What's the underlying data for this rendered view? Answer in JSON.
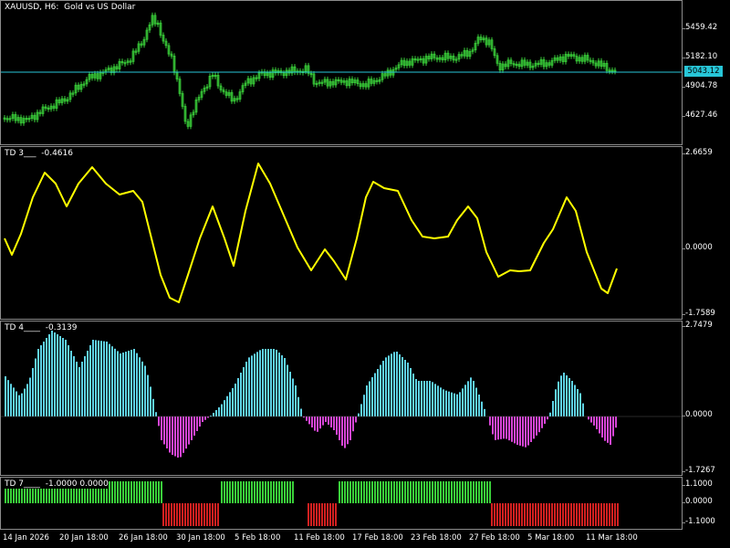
{
  "main": {
    "title": "XAUUSD, H6:  Gold vs US Dollar",
    "price_ticks": [
      "5459.42",
      "5182.10",
      "4904.78",
      "4627.46"
    ],
    "current_price": "5043.12",
    "candle_color": "#3ad13a",
    "hline_color": "#27c6d8"
  },
  "td3": {
    "label": "TD 3___  -0.4616",
    "ticks": [
      "2.6659",
      "0.0000",
      "-1.7589"
    ],
    "line_color": "#ffff00"
  },
  "td4": {
    "label": "TD 4____  -0.3139",
    "ticks": [
      "2.7479",
      "0.0000",
      "-1.7267"
    ],
    "pos_color": "#5fd3e6",
    "neg_color": "#d846d8"
  },
  "td7": {
    "label": "TD 7____  -1.0000 0.0000",
    "ticks": [
      "1.1000",
      "0.0000",
      "-1.1000"
    ],
    "up_color": "#3ad13a",
    "down_color": "#d42020"
  },
  "dates": [
    "14 Jan 2026",
    "20 Jan 18:00",
    "26 Jan 18:00",
    "30 Jan 18:00",
    "5 Feb 18:00",
    "11 Feb 18:00",
    "17 Feb 18:00",
    "23 Feb 18:00",
    "27 Feb 18:00",
    "5 Mar 18:00",
    "11 Mar 18:00"
  ]
}
